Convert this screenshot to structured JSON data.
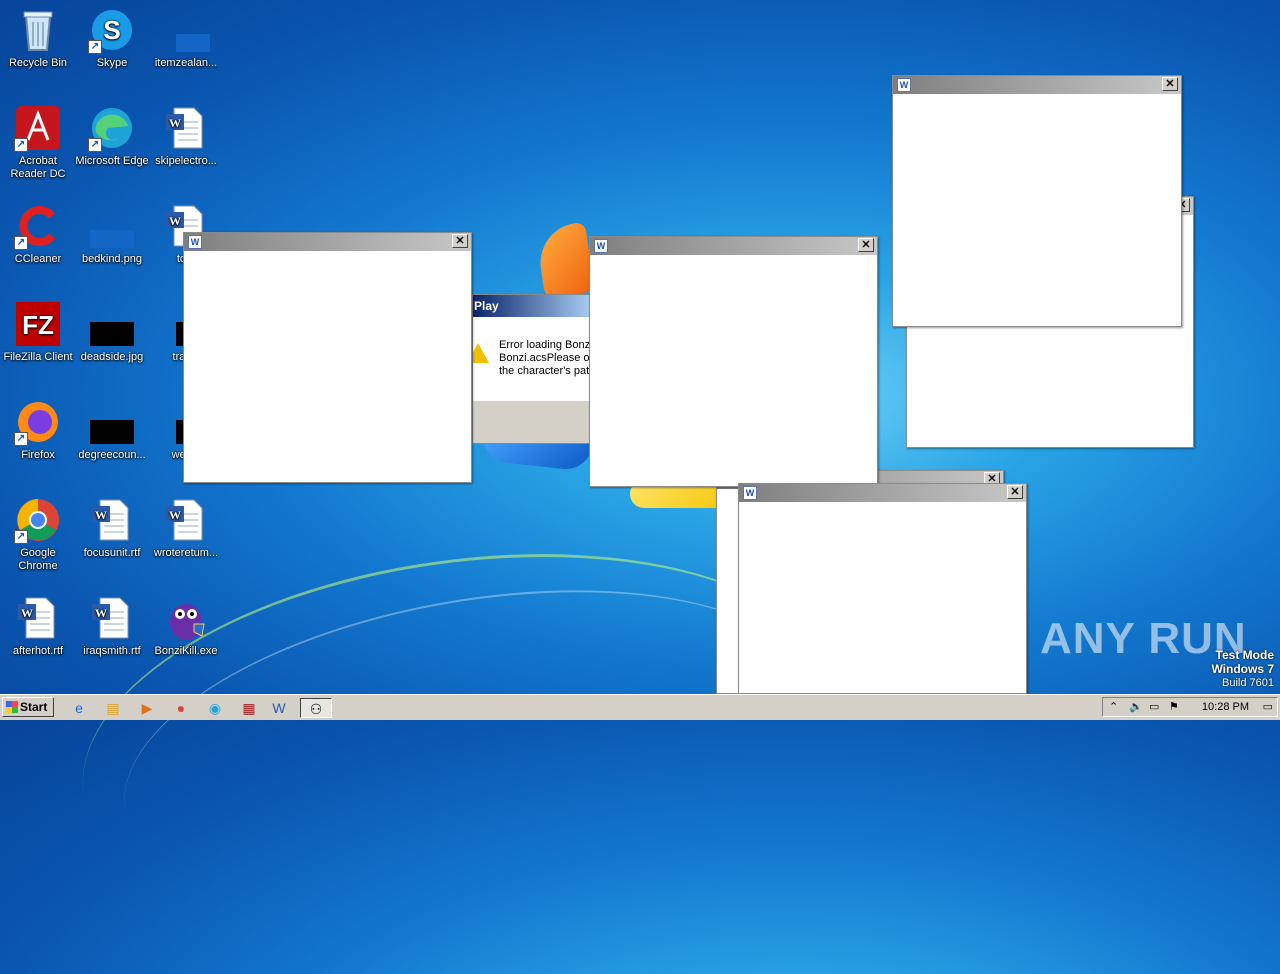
{
  "desktop_icons": [
    {
      "label": "Recycle Bin",
      "icon": "recycle-bin-icon"
    },
    {
      "label": "Skype",
      "icon": "skype-icon"
    },
    {
      "label": "itemzealan...",
      "icon": "blue-file-icon"
    },
    {
      "label": "Acrobat\nReader DC",
      "icon": "acrobat-icon"
    },
    {
      "label": "Microsoft Edge",
      "icon": "edge-icon"
    },
    {
      "label": "skipelectro...",
      "icon": "word-doc-icon"
    },
    {
      "label": "CCleaner",
      "icon": "ccleaner-icon"
    },
    {
      "label": "bedkind.png",
      "icon": "image-thumb-icon"
    },
    {
      "label": "tota",
      "icon": "word-doc-icon"
    },
    {
      "label": "FileZilla Client",
      "icon": "filezilla-icon"
    },
    {
      "label": "deadside.jpg",
      "icon": "black-thumb-icon"
    },
    {
      "label": "traditi",
      "icon": "black-thumb-icon"
    },
    {
      "label": "Firefox",
      "icon": "firefox-icon"
    },
    {
      "label": "degreecoun...",
      "icon": "black-thumb-icon"
    },
    {
      "label": "weste",
      "icon": "black-thumb-icon"
    },
    {
      "label": "Google\nChrome",
      "icon": "chrome-icon"
    },
    {
      "label": "focusunit.rtf",
      "icon": "word-doc-icon"
    },
    {
      "label": "wroteretum...",
      "icon": "word-doc-icon"
    },
    {
      "label": "afterhot.rtf",
      "icon": "word-doc-icon"
    },
    {
      "label": "iraqsmith.rtf",
      "icon": "word-doc-icon"
    },
    {
      "label": "BonziKill.exe",
      "icon": "bonzi-icon"
    }
  ],
  "dialog": {
    "title": "Play",
    "message": "Error loading Bonzi\nBonzi.acsPlease op\nthe character's pat"
  },
  "windows": {
    "close_glyph": "✕",
    "app_icon_text": "W"
  },
  "taskbar": {
    "start_label": "Start",
    "clock": "10:28 PM"
  },
  "watermark": {
    "text": "ANY RUN",
    "test_mode": "Test Mode",
    "os": "Windows 7",
    "build": "Build 7601"
  }
}
